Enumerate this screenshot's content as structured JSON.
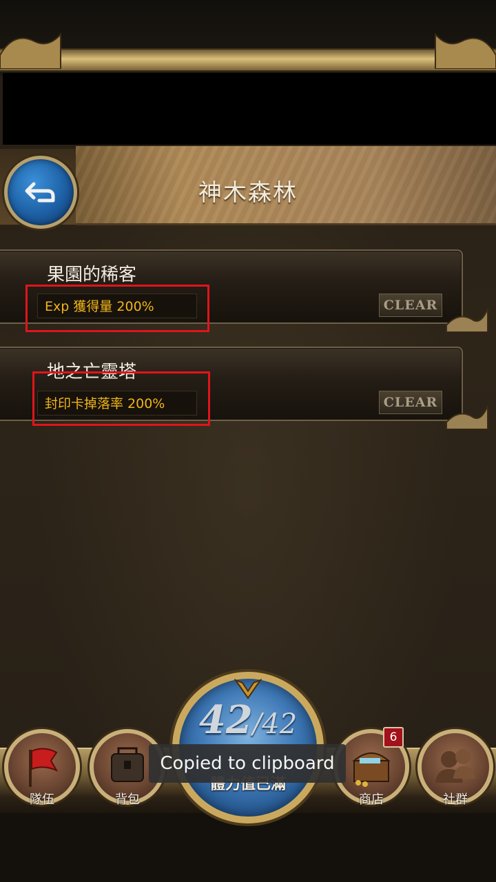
{
  "header": {
    "title": "神木森林"
  },
  "quests": [
    {
      "title": "果園的稀客",
      "reward": "Exp 獲得量 200%",
      "status": "CLEAR"
    },
    {
      "title": "地之亡靈塔",
      "reward": "封印卡掉落率 200%",
      "status": "CLEAR"
    }
  ],
  "nav": {
    "team": "隊伍",
    "bag": "背包",
    "shop": "商店",
    "shop_badge": "6",
    "social": "社群"
  },
  "stamina": {
    "current": "42",
    "max": "/42",
    "label": "體力值已滿"
  },
  "toast": {
    "message": "Copied to clipboard"
  },
  "colors": {
    "reward_text": "#f2b519",
    "highlight": "#e1141c",
    "back_button": "#1d5fa3"
  }
}
